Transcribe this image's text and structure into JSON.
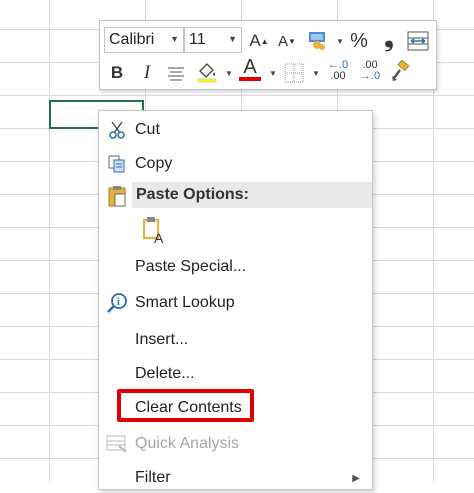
{
  "toolbar": {
    "font_name": "Calibri",
    "font_size": "11",
    "grow_font": "A",
    "shrink_font": "A",
    "percent": "%",
    "comma": "❟",
    "bold": "B",
    "italic": "I",
    "font_color_letter": "A",
    "increase_decimal_top": "←.0",
    "increase_decimal_bottom": ".00",
    "decrease_decimal_top": ".00",
    "decrease_decimal_bottom": "→.0",
    "font_color": "#e00000"
  },
  "menu": {
    "cut": "Cut",
    "copy": "Copy",
    "paste_options": "Paste Options:",
    "paste_special": "Paste Special...",
    "smart_lookup": "Smart Lookup",
    "insert": "Insert...",
    "delete": "Delete...",
    "clear_contents": "Clear Contents",
    "quick_analysis": "Quick Analysis",
    "filter": "Filter"
  },
  "colors": {
    "selection": "#217346",
    "highlight": "#e00000",
    "accent_blue": "#2b6cb0"
  }
}
